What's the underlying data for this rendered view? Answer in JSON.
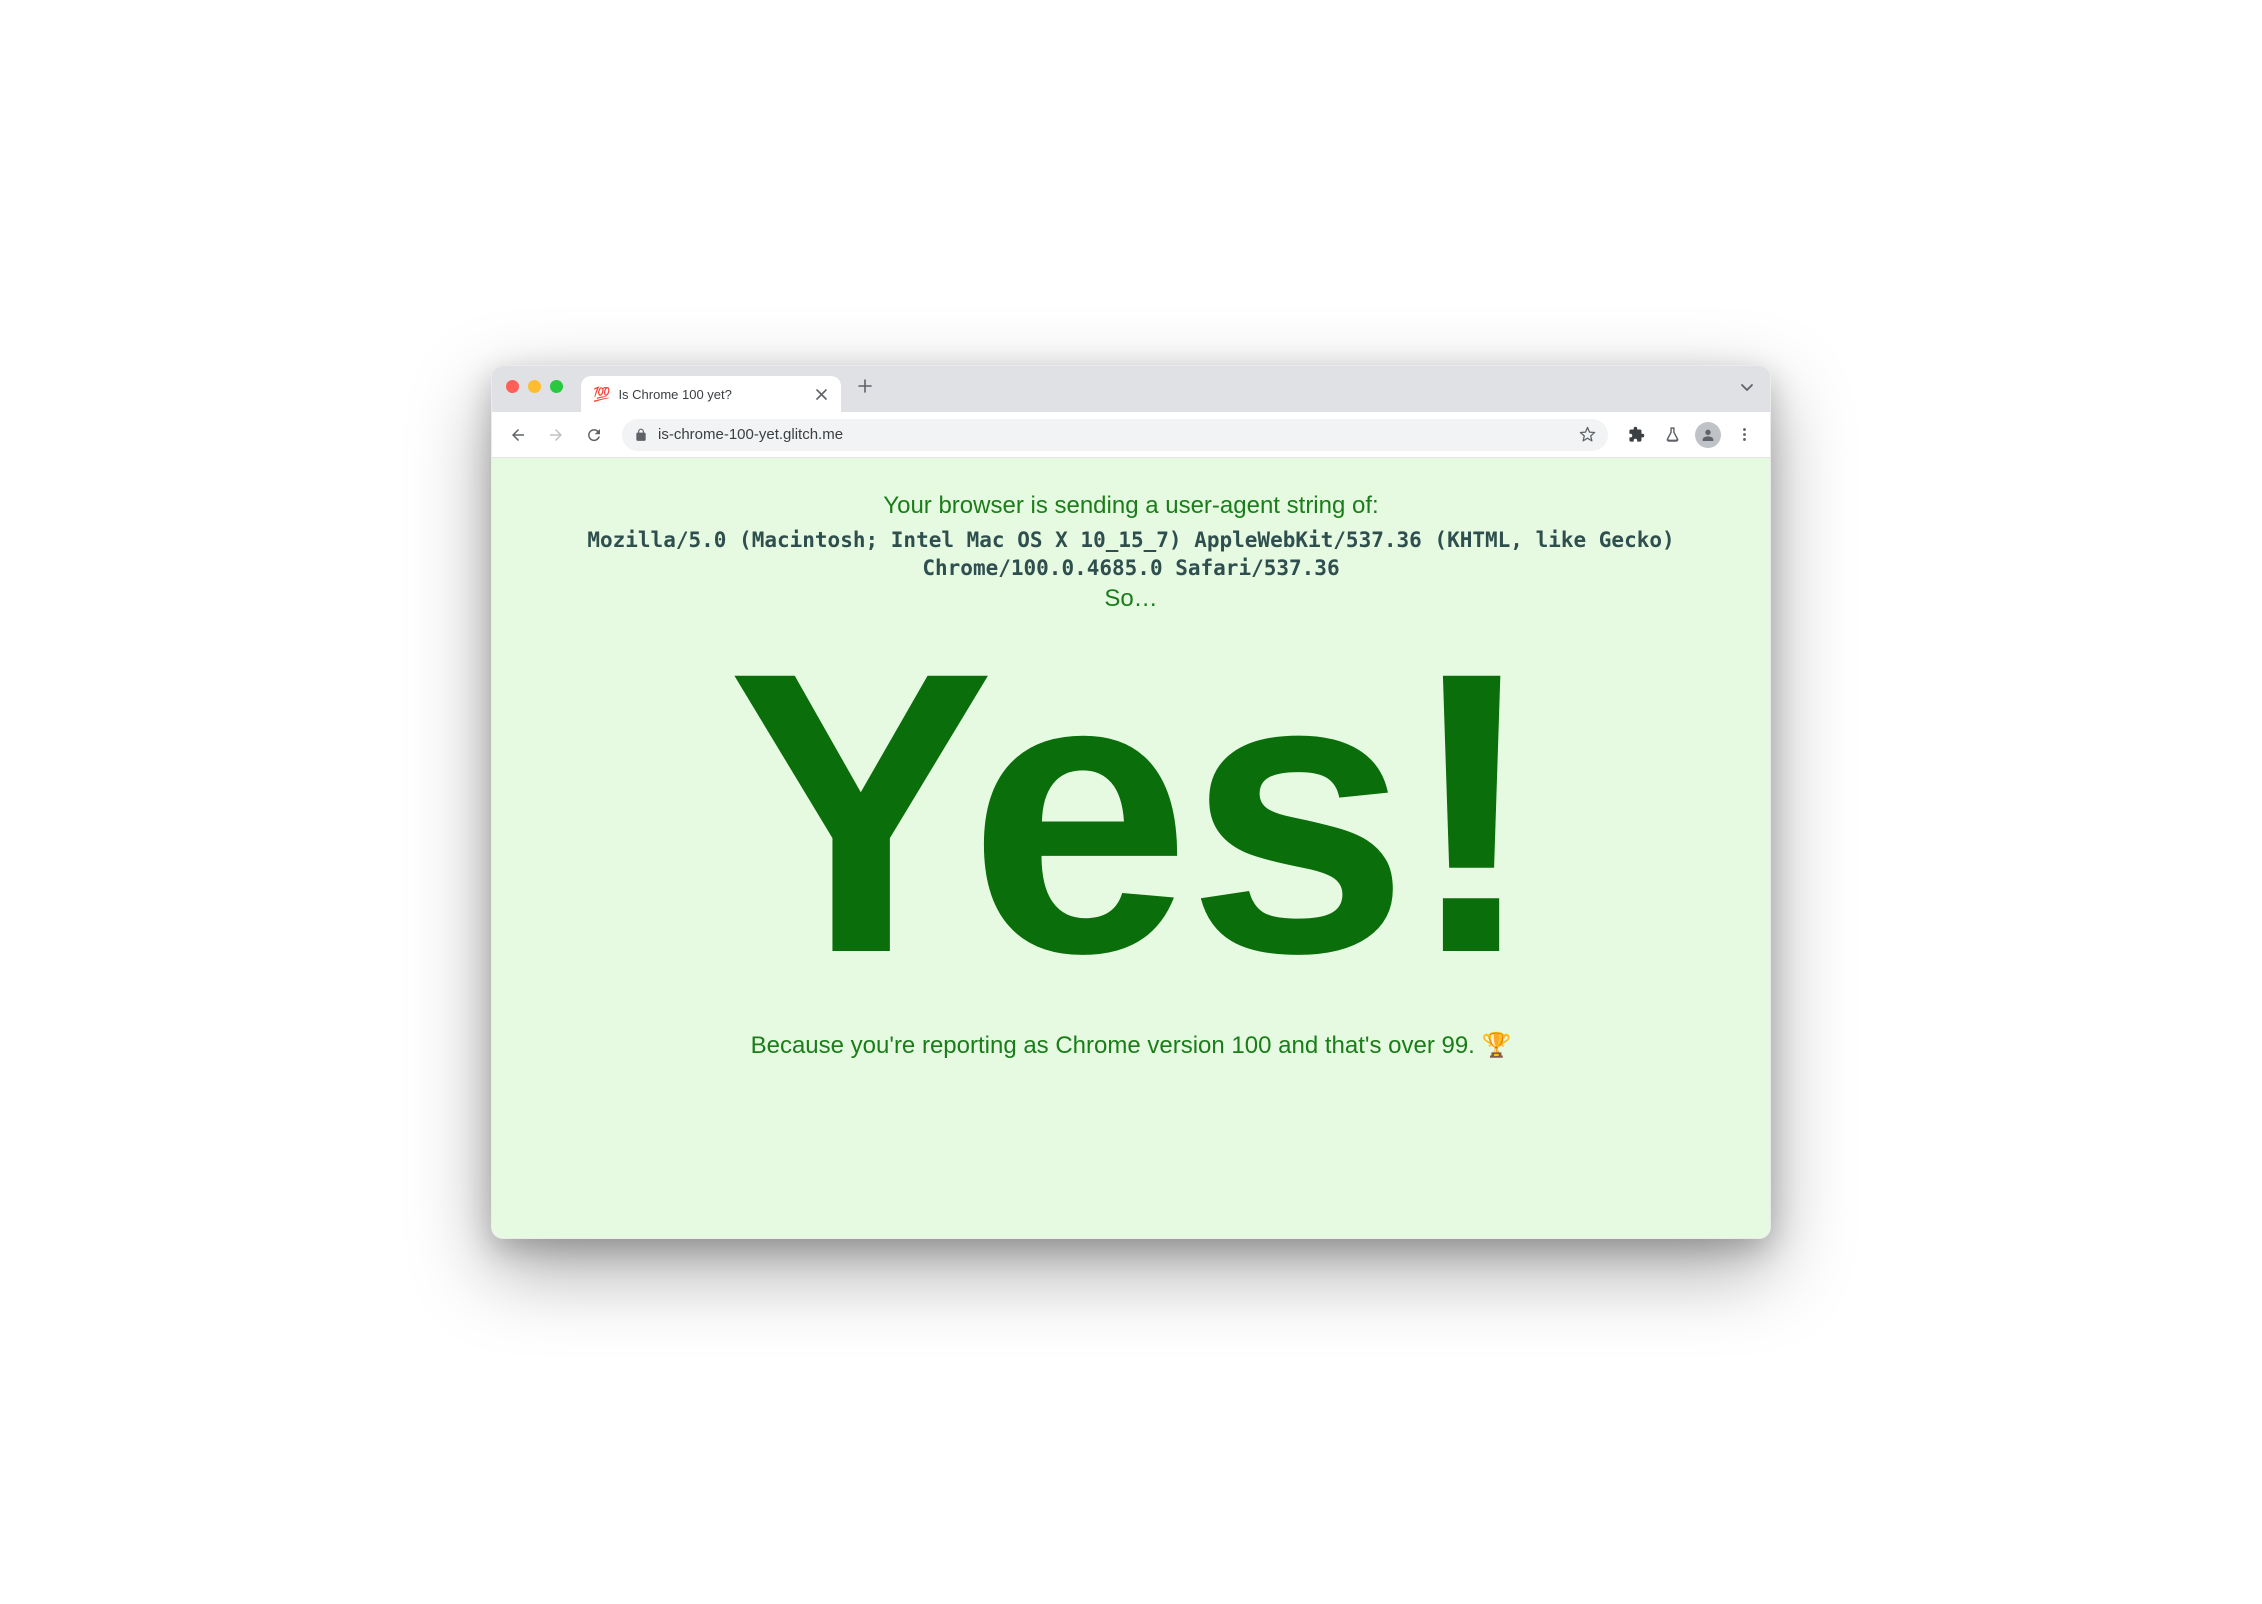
{
  "window": {
    "tab": {
      "favicon": "💯",
      "title": "Is Chrome 100 yet?"
    }
  },
  "toolbar": {
    "url": "is-chrome-100-yet.glitch.me"
  },
  "page": {
    "intro": "Your browser is sending a user-agent string of:",
    "user_agent": "Mozilla/5.0 (Macintosh; Intel Mac OS X 10_15_7) AppleWebKit/537.36 (KHTML, like Gecko) Chrome/100.0.4685.0 Safari/537.36",
    "so": "So…",
    "answer": "Yes!",
    "because": "Because you're reporting as Chrome version 100 and that's over 99. 🏆"
  }
}
